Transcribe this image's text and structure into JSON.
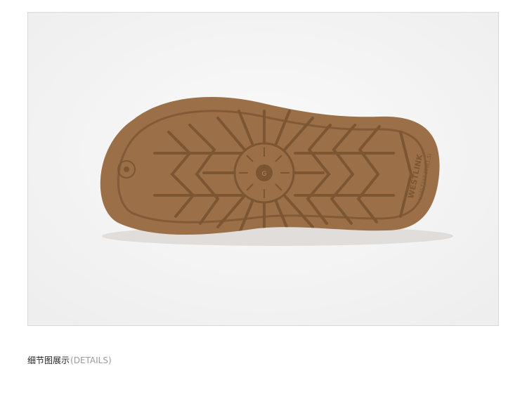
{
  "image": {
    "subject": "shoe sole",
    "sole_brand_text": "WESTLINK",
    "sole_code_text": "V2457337 220(1.5)",
    "colors": {
      "sole": "#9b7048",
      "groove": "#7c5533",
      "background": "#f4f4f4"
    }
  },
  "caption": {
    "cn": "细节图展示",
    "en": "(DETAILS)"
  }
}
